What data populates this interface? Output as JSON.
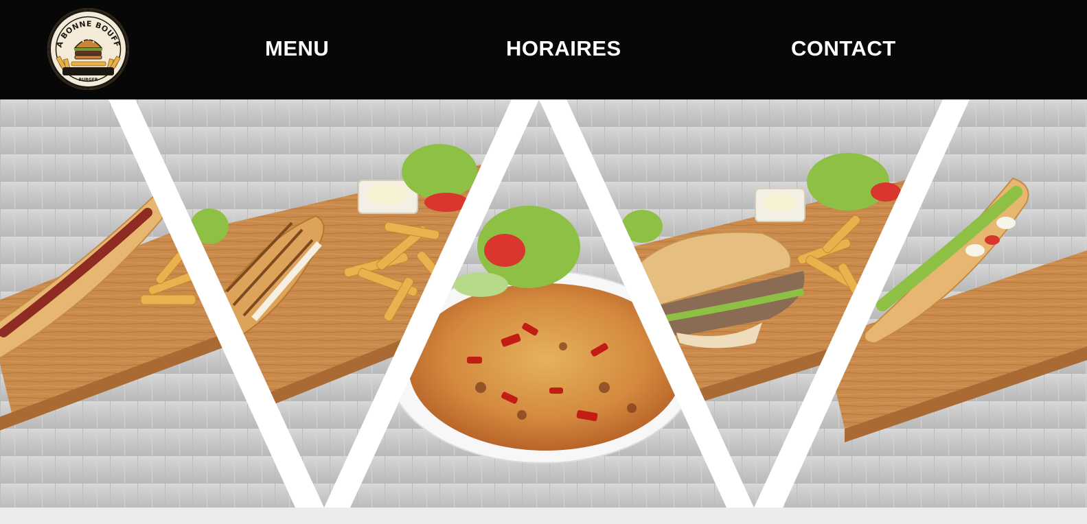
{
  "header": {
    "logo": {
      "icon": "burger-fries-badge",
      "top_text": "LA BONNE BOUFFE",
      "bottom_text": "BURGER"
    },
    "nav": [
      {
        "label": "MENU"
      },
      {
        "label": "HORAIRES"
      },
      {
        "label": "CONTACT"
      }
    ]
  },
  "hero": {
    "panels": [
      {
        "dish": "baguette-sandwich-with-fries"
      },
      {
        "dish": "panini-with-fries-salad-mayonnaise"
      },
      {
        "dish": "pizza-with-salad"
      },
      {
        "dish": "kebab-sandwich-with-fries"
      },
      {
        "dish": "salad-baguette-sandwich"
      }
    ]
  },
  "colors": {
    "header_bg": "#070707",
    "nav_text": "#ffffff",
    "separator": "#ffffff",
    "wood": "#c98a4b",
    "table_grey": "#c9c9c9"
  }
}
